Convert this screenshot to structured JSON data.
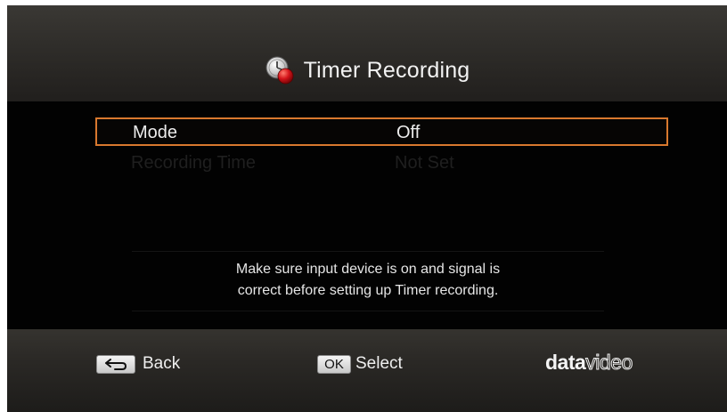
{
  "header": {
    "title": "Timer Recording",
    "icon": "timer-record-icon"
  },
  "settings": {
    "rows": [
      {
        "label": "Mode",
        "value": "Off",
        "state": "selected"
      },
      {
        "label": "Recording Time",
        "value": "Not Set",
        "state": "disabled"
      }
    ]
  },
  "note": {
    "line1": "Make sure input device is on and signal is",
    "line2": "correct before setting up Timer recording."
  },
  "footer": {
    "back_label": "Back",
    "back_icon": "return-arrow-icon",
    "ok_key": "OK",
    "select_label": "Select",
    "brand_bold": "data",
    "brand_light": "video"
  },
  "colors": {
    "selection_border": "#d8782e",
    "record_dot": "#d4141a",
    "background": "#000000"
  }
}
